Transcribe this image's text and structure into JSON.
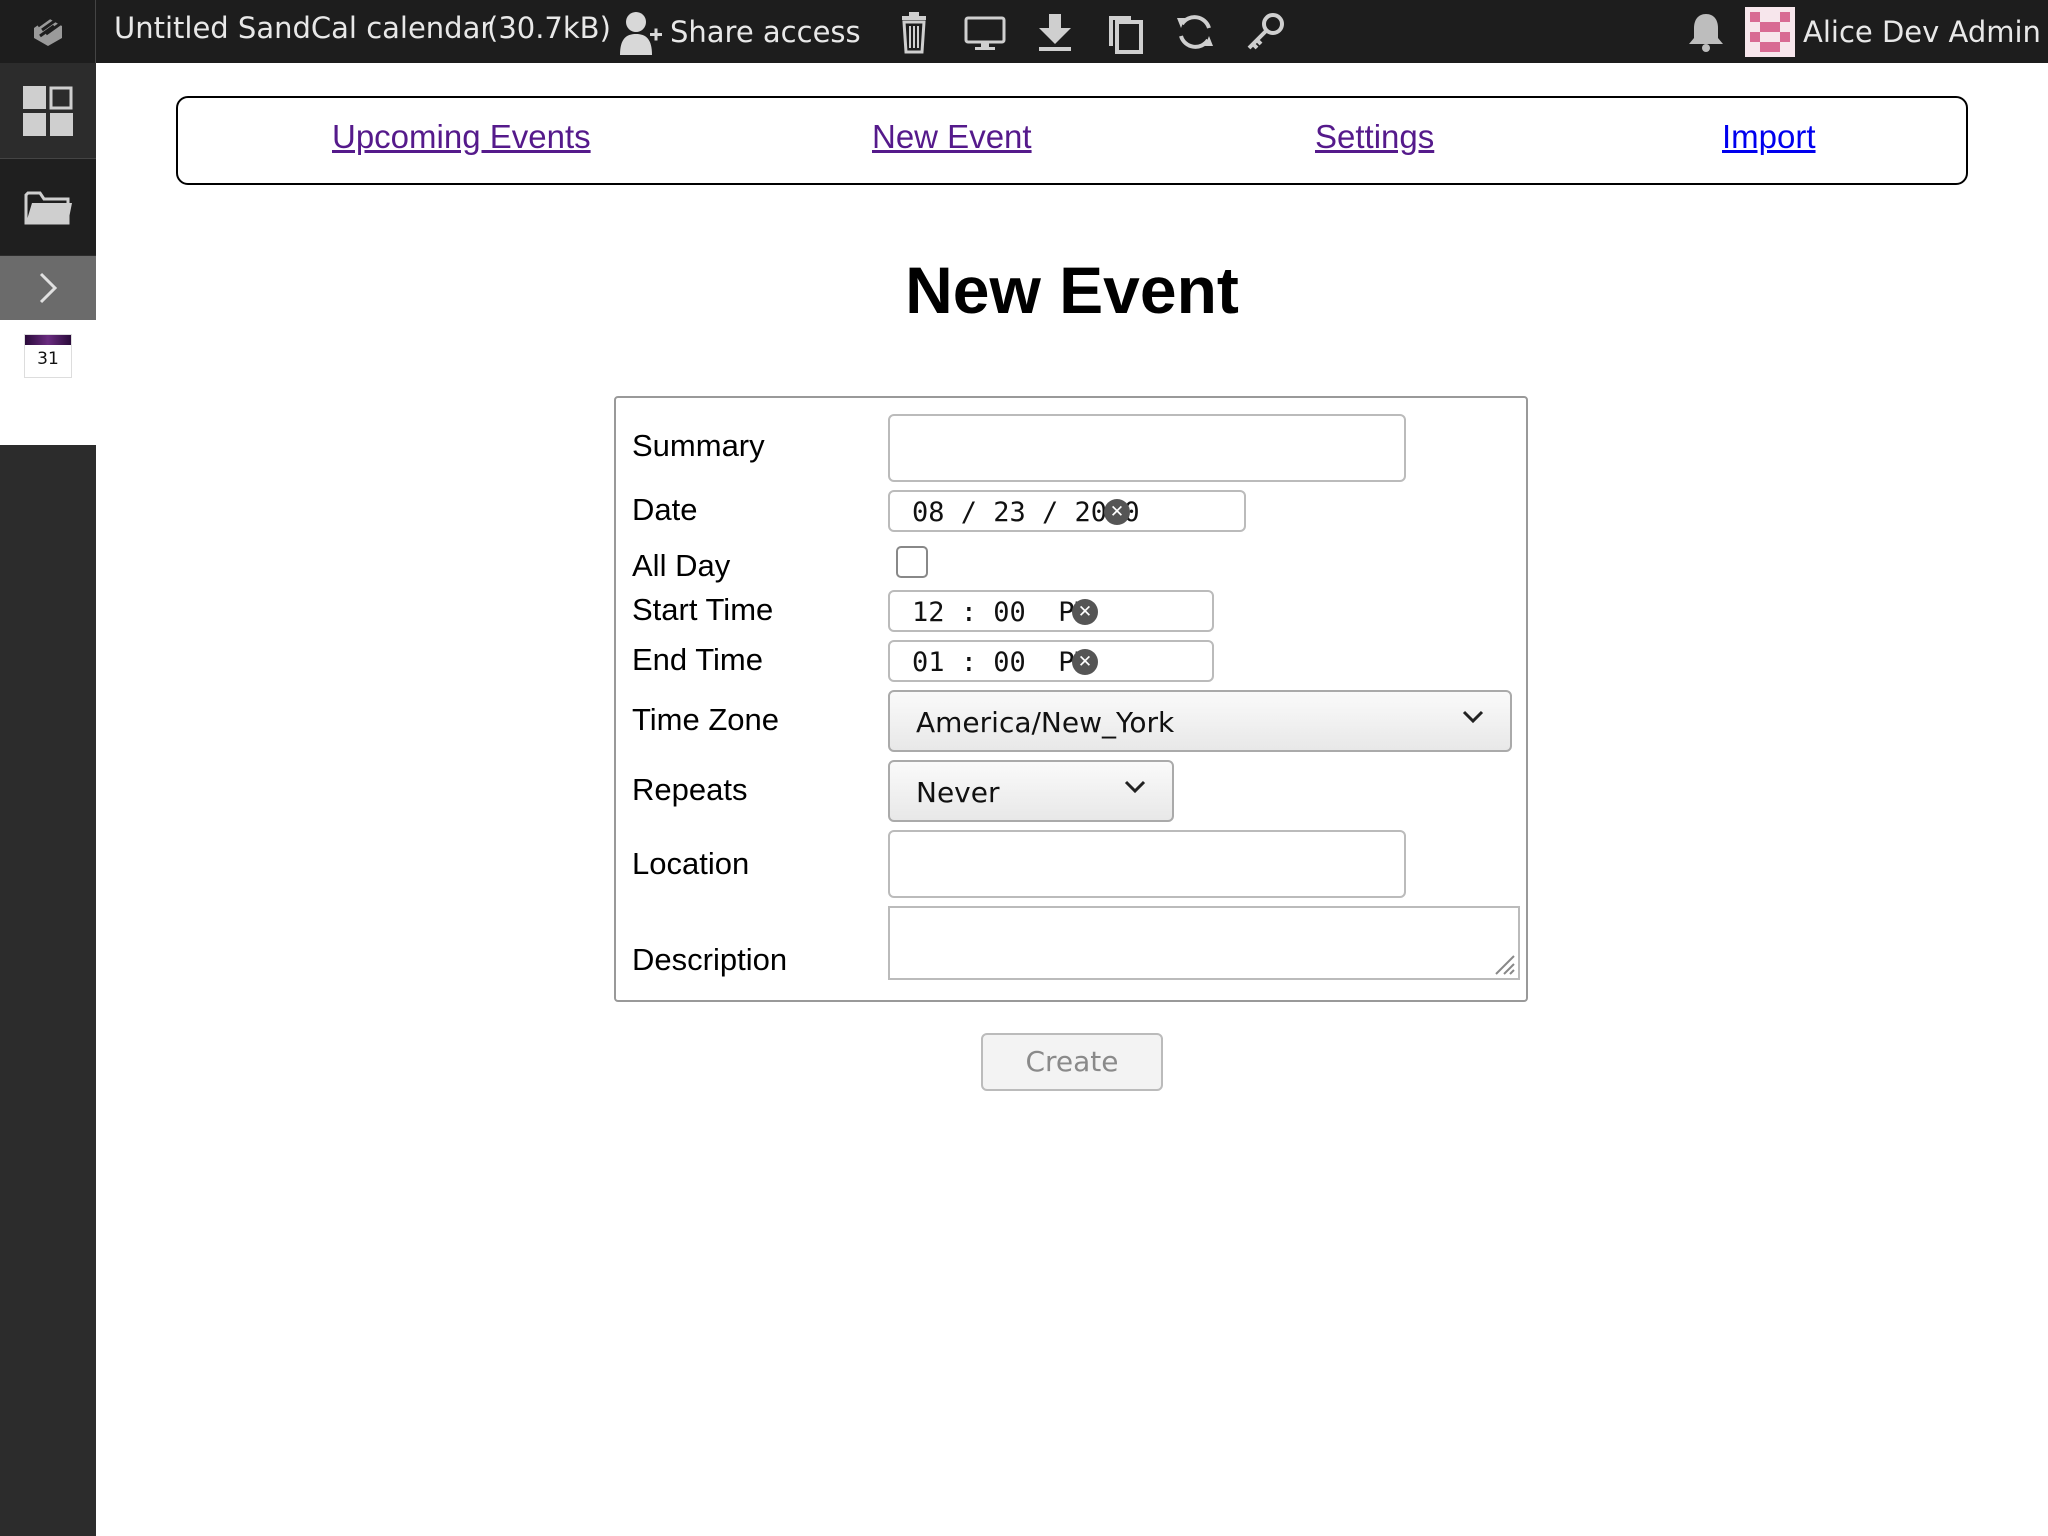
{
  "topbar": {
    "grain_title": "Untitled SandCal calendar",
    "grain_size": "(30.7kB)",
    "share_label": "Share access",
    "icons": [
      "share-user-icon",
      "trash-icon",
      "monitor-icon",
      "download-icon",
      "copy-icon",
      "restart-icon",
      "key-icon",
      "bell-icon"
    ],
    "user_name": "Alice Dev Admin",
    "user_caret": "▾"
  },
  "sidebar": {
    "items": [
      "apps-grid-icon",
      "folder-icon",
      "expand-chevron-icon",
      "calendar-app-icon"
    ],
    "calendar_day": "31"
  },
  "nav": {
    "upcoming": "Upcoming Events",
    "new_event": "New Event",
    "settings": "Settings",
    "import": "Import"
  },
  "page_title": "New Event",
  "form": {
    "summary_label": "Summary",
    "summary_value": "",
    "date_label": "Date",
    "date_value": "08 / 23 / 2020",
    "allday_label": "All Day",
    "allday_checked": false,
    "start_label": "Start Time",
    "start_value": "12 : 00  PM",
    "end_label": "End Time",
    "end_value": "01 : 00  PM",
    "timezone_label": "Time Zone",
    "timezone_value": "America/New_York",
    "repeats_label": "Repeats",
    "repeats_value": "Never",
    "location_label": "Location",
    "location_value": "",
    "description_label": "Description",
    "description_value": "",
    "create_label": "Create"
  },
  "colors": {
    "topbar_bg": "#1d1d1d",
    "sidebar_bg": "#2c2c2c",
    "link_visited": "#551a8b",
    "link": "#0000ee"
  }
}
